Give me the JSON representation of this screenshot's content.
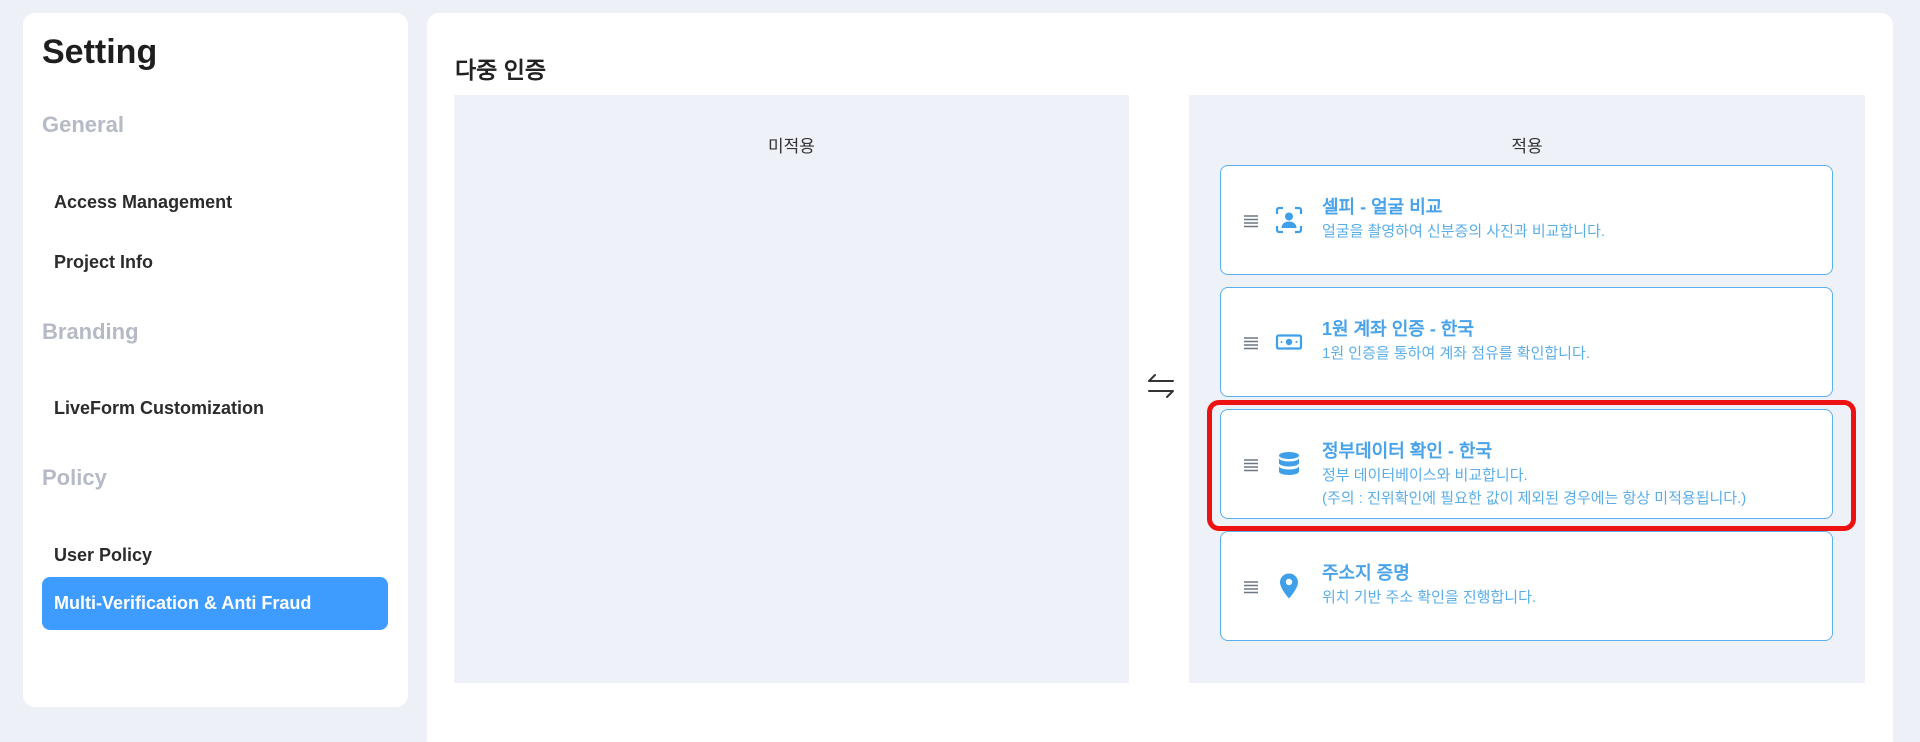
{
  "sidebar": {
    "title": "Setting",
    "sections": [
      {
        "label": "General",
        "items": [
          "Access Management",
          "Project Info"
        ]
      },
      {
        "label": "Branding",
        "items": [
          "LiveForm Customization"
        ]
      },
      {
        "label": "Policy",
        "items": [
          "User Policy",
          "Multi-Verification & Anti Fraud"
        ]
      }
    ],
    "active_item": "Multi-Verification & Anti Fraud"
  },
  "main": {
    "title": "다중 인증",
    "left_panel": {
      "header": "미적용",
      "items": []
    },
    "right_panel": {
      "header": "적용",
      "items": [
        {
          "icon": "face-scan-icon",
          "title": "셀피 - 얼굴 비교",
          "desc": "얼굴을 촬영하여 신분증의 사진과 비교합니다.",
          "note": ""
        },
        {
          "icon": "money-bill-icon",
          "title": "1원 계좌 인증 - 한국",
          "desc": "1원 인증을 통하여 계좌 점유를 확인합니다.",
          "note": ""
        },
        {
          "icon": "database-icon",
          "title": "정부데이터 확인 - 한국",
          "desc": "정부 데이터베이스와 비교합니다.",
          "note": "(주의 : 진위확인에 필요한 값이 제외된 경우에는 항상 미적용됩니다.)"
        },
        {
          "icon": "location-pin-icon",
          "title": "주소지 증명",
          "desc": "위치 기반 주소 확인을 진행합니다.",
          "note": ""
        }
      ]
    }
  },
  "colors": {
    "accent": "#3e9bff",
    "card_border": "#5ab0ee",
    "card_text": "#4aa3e8",
    "highlight": "#ee1111",
    "panel_bg": "#eff1f9"
  }
}
